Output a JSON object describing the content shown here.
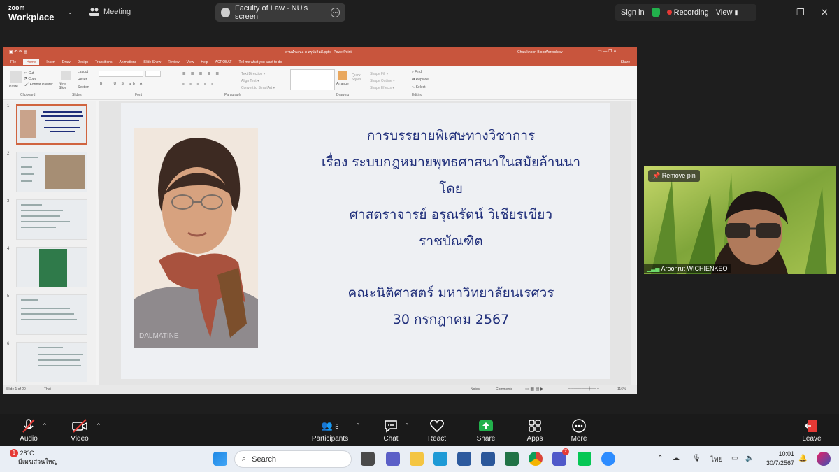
{
  "zoom": {
    "brand_line1": "zoom",
    "brand_line2": "Workplace",
    "meeting_label": "Meeting",
    "share_title": "Faculty of Law - NU's screen",
    "sign_in": "Sign in",
    "recording": "Recording",
    "view": "View",
    "toolbar": {
      "audio": "Audio",
      "video": "Video",
      "participants": "Participants",
      "participants_count": "5",
      "chat": "Chat",
      "react": "React",
      "share": "Share",
      "apps": "Apps",
      "more": "More",
      "leave": "Leave"
    },
    "participant": {
      "name": "Aroonrut WICHIENKEO",
      "remove_pin": "Remove pin"
    }
  },
  "powerpoint": {
    "window_title": "ถามนำเสนอ ต สรุปผลิตดี.pptx - PowerPoint",
    "user": "Chatukhoon Bloom/ีorerchow",
    "tabs": [
      "File",
      "Home",
      "Insert",
      "Draw",
      "Design",
      "Transitions",
      "Animations",
      "Slide Show",
      "Review",
      "View",
      "Help",
      "ACROBAT",
      "Tell me what you want to do"
    ],
    "active_tab": "Home",
    "share_btn": "Share",
    "ribbon_groups": [
      "Clipboard",
      "Slides",
      "Font",
      "Paragraph",
      "Drawing",
      "Editing"
    ],
    "ribbon_items": {
      "paste": "Paste",
      "new_slide": "New Slide",
      "layout": "Layout",
      "reset": "Reset",
      "section": "Section",
      "arrange": "Arrange",
      "quick_styles": "Quick Styles",
      "find": "Find",
      "replace": "Replace",
      "select": "Select"
    },
    "slide_numbers": [
      "1",
      "2",
      "3",
      "4",
      "5",
      "6"
    ],
    "status_left": "Slide 1 of 20",
    "status_lang": "Thai",
    "status_notes": "Notes",
    "status_comments": "Comments",
    "zoom_level": "116%",
    "slide": {
      "line1": "การบรรยายพิเศษทางวิชาการ",
      "line2": "เรื่อง ระบบกฎหมายพุทธศาสนาในสมัยล้านนา",
      "line3": "โดย",
      "line4": "ศาสตราจารย์ อรุณรัตน์ วิเชียรเขียว",
      "line5": "ราชบัณฑิต",
      "line6": "คณะนิติศาสตร์ มหาวิทยาลัยนเรศวร",
      "line7": "30 กรกฎาคม 2567",
      "title_color": "#1f2e7a"
    }
  },
  "taskbar": {
    "temp": "28°C",
    "weather_desc": "มีเมฆส่วนใหญ่",
    "weather_badge": "1",
    "search": "Search",
    "lang": "ไทย",
    "time": "10:01",
    "date": "30/7/2567",
    "teams_badge": "7"
  },
  "colors": {
    "ppt_accent": "#c8553d",
    "zoom_share_green": "#22b14c",
    "recording_red": "#e53935"
  }
}
